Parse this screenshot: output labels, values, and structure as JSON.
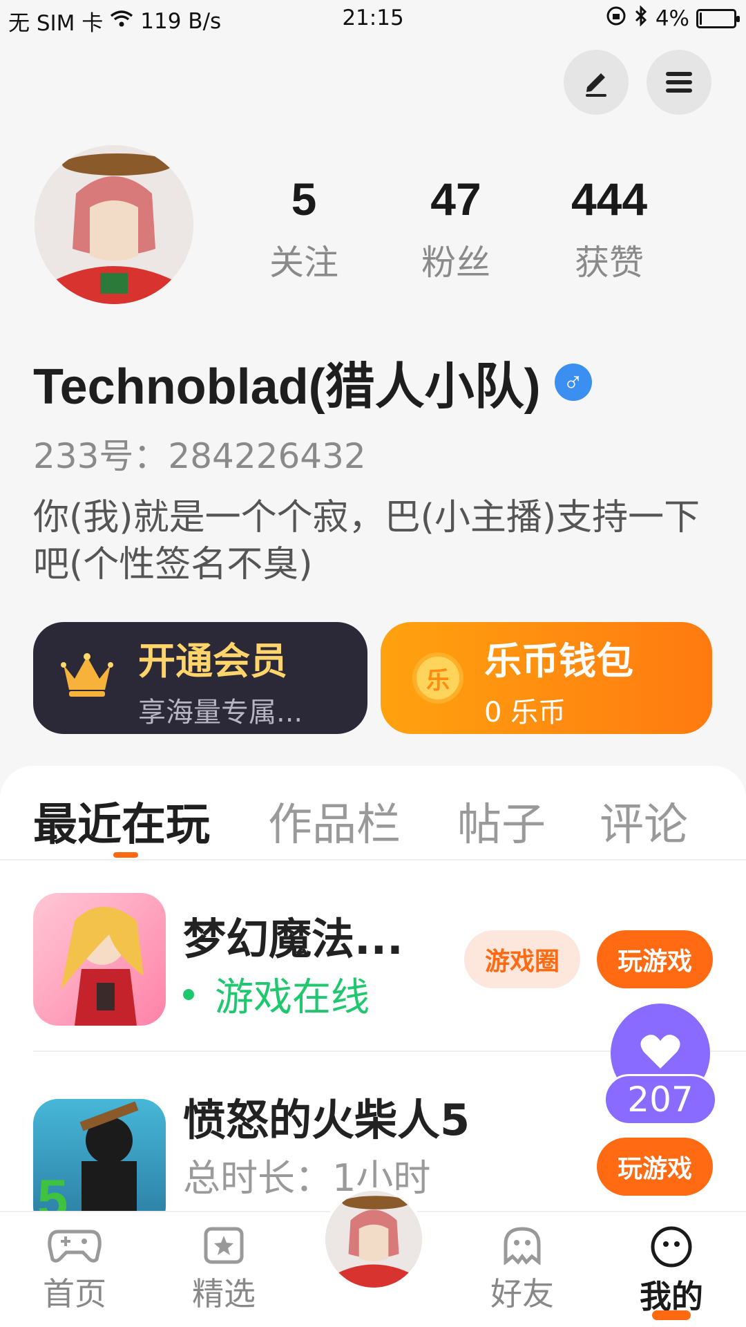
{
  "status_bar": {
    "carrier": "无 SIM 卡",
    "speed": "119 B/s",
    "time": "21:15",
    "battery": "4%",
    "battery_level": 0.04
  },
  "profile": {
    "stats": [
      {
        "value": "5",
        "label": "关注"
      },
      {
        "value": "47",
        "label": "粉丝"
      },
      {
        "value": "444",
        "label": "获赞"
      }
    ],
    "nickname": "Technoblad(猎人小队)",
    "gender_symbol": "♂",
    "uid": "233号：284226432",
    "signature": "你(我)就是一个个寂，巴(小主播)支持一下吧(个性签名不臭)"
  },
  "cards": {
    "vip": {
      "title": "开通会员",
      "subtitle": "享海量专属..."
    },
    "wallet": {
      "title": "乐币钱包",
      "subtitle": "0 乐币",
      "coin_glyph": "乐"
    }
  },
  "tabs": [
    "最近在玩",
    "作品栏",
    "帖子",
    "评论"
  ],
  "games": [
    {
      "title": "梦幻魔法...",
      "status": "游戏在线",
      "circle_label": "游戏圈",
      "play_label": "玩游戏"
    },
    {
      "title": "愤怒的火柴人5",
      "subtitle": "总时长：1小时",
      "play_label": "玩游戏"
    }
  ],
  "likes": {
    "count": "207"
  },
  "nav": [
    "首页",
    "精选",
    "好友",
    "我的"
  ],
  "colors": {
    "accent": "#ff6a10",
    "online_green": "#1fc86e",
    "vip_bg": "#2b2838",
    "vip_gold": "#ffd46a",
    "like_purple": "#8a6bff"
  }
}
